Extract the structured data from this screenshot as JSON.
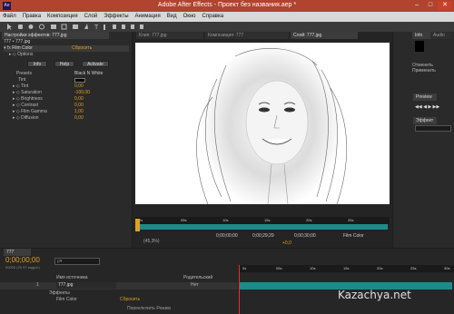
{
  "window": {
    "title": "Adobe After Effects - Проект без названия.aep *",
    "logo": "Ae"
  },
  "menu": [
    "Файл",
    "Правка",
    "Композиция",
    "Слой",
    "Эффекты",
    "Анимация",
    "Вид",
    "Окно",
    "Справка"
  ],
  "effects_panel": {
    "tab_label": "Настройки эффектов: 777.jpg",
    "header": "777 • 777.jpg",
    "effect_name": "Film Color",
    "reset_label": "Сбросить",
    "options_label": "Options",
    "buttons": [
      "Info",
      "Help",
      "Activate"
    ],
    "presets_label": "Presets",
    "presets_value": "Black N White",
    "tint_label": "Tint",
    "params": [
      {
        "name": "Tint",
        "value": "0,00"
      },
      {
        "name": "Saturation",
        "value": "-100,00"
      },
      {
        "name": "Brightness",
        "value": "0,00"
      },
      {
        "name": "Contrast",
        "value": "0,00"
      },
      {
        "name": "Film Gamma",
        "value": "1,00"
      },
      {
        "name": "Diffusion",
        "value": "0,00"
      }
    ]
  },
  "viewer": {
    "tabs": [
      "Клип: 777.jpg",
      "Композиция: 777",
      "Слой: 777.jpg"
    ],
    "ruler_ticks": [
      "0s",
      "05s",
      "10s",
      "15s",
      "20s",
      "25s"
    ],
    "controls": {
      "zoom": "(45,3%)",
      "time": "0;00;00;00",
      "duration": "0;00;29;29",
      "delta": "0;00;30;00",
      "view": "Film Color",
      "offset": "+0,0"
    }
  },
  "right_panel": {
    "info_tab": "Info",
    "audio_tab": "Audio",
    "undo_label": "Отменить",
    "apply_label": "Применить",
    "preview_tab": "Preview",
    "effects_tab": "Эффект"
  },
  "timeline": {
    "tab": "777",
    "time": "0;00;00;00",
    "fps": "00000 (29.97 кадр/с)",
    "search_placeholder": "ρ▾",
    "columns": {
      "name": "Имя источника",
      "parent": "Родительский"
    },
    "layer_num": "1",
    "layer_name": "777.jpg",
    "parent_value": "Нет",
    "effects_label": "Эффекты",
    "effect_row": "Film Color",
    "effect_reset": "Сбросить",
    "switch_label": "Переключить Режим",
    "ruler_ticks": [
      "0s",
      "05s",
      "10s",
      "15s",
      "20s",
      "25s",
      "30s"
    ]
  },
  "watermark": "Kazachya.net",
  "colors": {
    "titlebar": "#b0442f",
    "accent": "#e0a020",
    "timeline_bar": "#1f8a8a"
  }
}
